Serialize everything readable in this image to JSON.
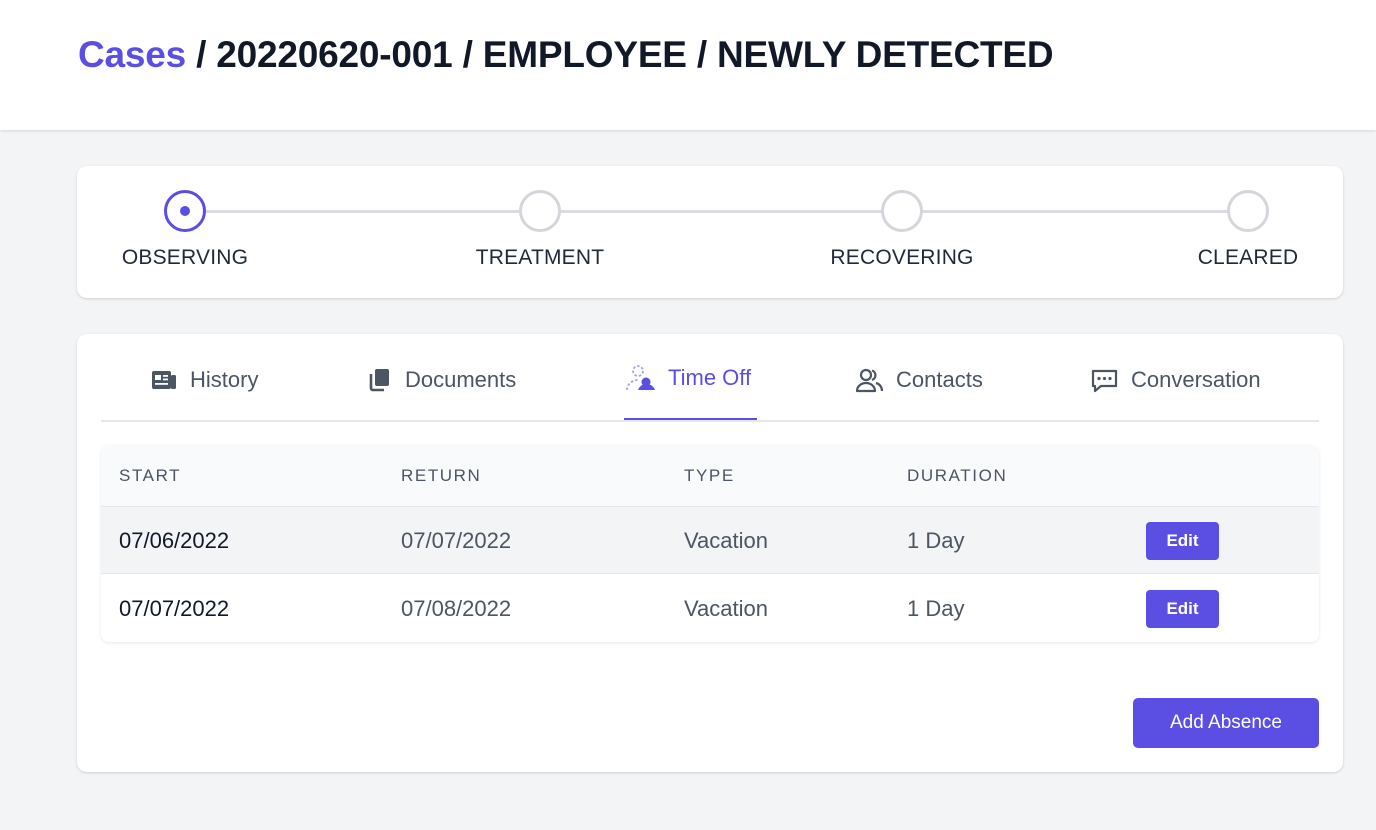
{
  "breadcrumb": {
    "root": "Cases",
    "rest": " / 20220620-001 / EMPLOYEE / NEWLY DETECTED"
  },
  "stepper": {
    "steps": [
      {
        "label": "OBSERVING",
        "active": true
      },
      {
        "label": "TREATMENT",
        "active": false
      },
      {
        "label": "RECOVERING",
        "active": false
      },
      {
        "label": "CLEARED",
        "active": false
      }
    ]
  },
  "tabs": [
    {
      "label": "History",
      "icon": "newspaper-icon",
      "active": false
    },
    {
      "label": "Documents",
      "icon": "documents-icon",
      "active": false
    },
    {
      "label": "Time Off",
      "icon": "user-time-off-icon",
      "active": true
    },
    {
      "label": "Contacts",
      "icon": "users-icon",
      "active": false
    },
    {
      "label": "Conversation",
      "icon": "chat-icon",
      "active": false
    }
  ],
  "table": {
    "headers": [
      "START",
      "RETURN",
      "TYPE",
      "DURATION"
    ],
    "rows": [
      {
        "start": "07/06/2022",
        "return": "07/07/2022",
        "type": "Vacation",
        "duration": "1 Day",
        "action": "Edit"
      },
      {
        "start": "07/07/2022",
        "return": "07/08/2022",
        "type": "Vacation",
        "duration": "1 Day",
        "action": "Edit"
      }
    ]
  },
  "actions": {
    "add_absence": "Add Absence"
  },
  "colors": {
    "accent": "#5a4ee3",
    "text_dark": "#111827",
    "text_muted": "#4b5563"
  }
}
